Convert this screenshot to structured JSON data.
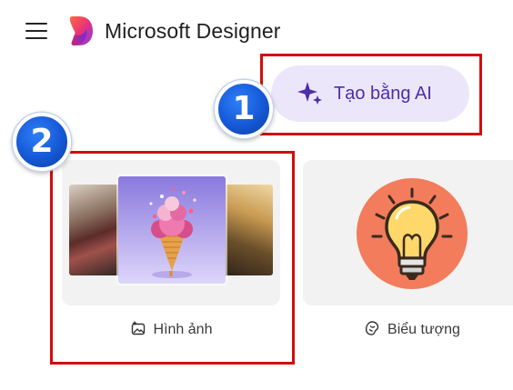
{
  "header": {
    "app_title": "Microsoft Designer",
    "menu_icon": "hamburger-menu-icon",
    "logo_icon": "microsoft-designer-logo"
  },
  "ai_button": {
    "label": "Tạo bằng AI",
    "icon": "sparkle-icon",
    "background": "#ece6fb",
    "text_color": "#4c2ea8"
  },
  "annotations": {
    "step_1": "1",
    "step_2": "2",
    "highlight_color": "#d40c0c",
    "badge_color": "#1558d6"
  },
  "cards": [
    {
      "label": "Hình ảnh",
      "icon": "image-sparkle-icon"
    },
    {
      "label": "Biểu tượng",
      "icon": "sticker-icon"
    }
  ]
}
